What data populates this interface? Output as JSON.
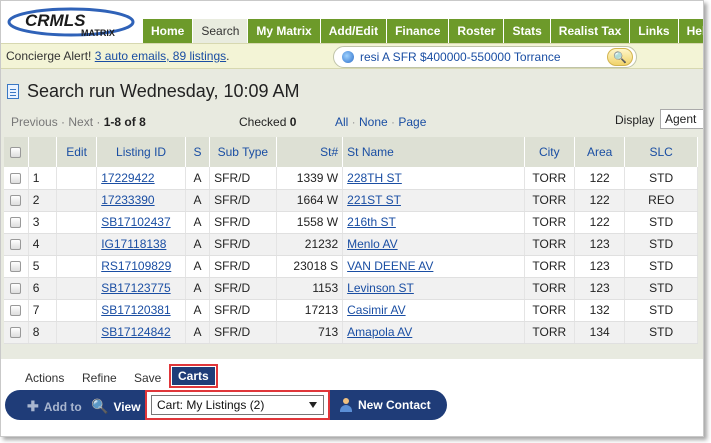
{
  "logo": {
    "brand": "CRMLS",
    "product": "MATRIX"
  },
  "nav": {
    "tabs": [
      {
        "label": "Home",
        "active": false
      },
      {
        "label": "Search",
        "active": true
      },
      {
        "label": "My Matrix",
        "active": false
      },
      {
        "label": "Add/Edit",
        "active": false
      },
      {
        "label": "Finance",
        "active": false
      },
      {
        "label": "Roster",
        "active": false
      },
      {
        "label": "Stats",
        "active": false
      },
      {
        "label": "Realist Tax",
        "active": false
      },
      {
        "label": "Links",
        "active": false
      },
      {
        "label": "Help",
        "active": false
      }
    ]
  },
  "concierge": {
    "label": "Concierge Alert!",
    "link": "3 auto emails, 89 listings",
    "period": "."
  },
  "search": {
    "value": "resi A SFR $400000-550000 Torrance"
  },
  "page": {
    "title": "Search run Wednesday, 10:09 AM"
  },
  "pager": {
    "previous": "Previous",
    "next": "Next",
    "range": "1-8",
    "of": "of",
    "total": "8"
  },
  "checked": {
    "label": "Checked",
    "count": "0"
  },
  "select_links": {
    "all": "All",
    "none": "None",
    "page": "Page"
  },
  "display": {
    "label": "Display",
    "value": "Agent"
  },
  "table": {
    "headers": [
      "",
      "",
      "Edit",
      "Listing ID",
      "S",
      "Sub Type",
      "St#",
      "St Name",
      "City",
      "Area",
      "SLC"
    ],
    "rows": [
      {
        "n": "1",
        "id": "17229422",
        "s": "A",
        "sub": "SFR/D",
        "stno": "1339 W",
        "stname": "228TH ST",
        "city": "TORR",
        "area": "122",
        "slc": "STD"
      },
      {
        "n": "2",
        "id": "17233390",
        "s": "A",
        "sub": "SFR/D",
        "stno": "1664 W",
        "stname": "221ST ST",
        "city": "TORR",
        "area": "122",
        "slc": "REO"
      },
      {
        "n": "3",
        "id": "SB17102437",
        "s": "A",
        "sub": "SFR/D",
        "stno": "1558 W",
        "stname": "216th ST",
        "city": "TORR",
        "area": "122",
        "slc": "STD"
      },
      {
        "n": "4",
        "id": "IG17118138",
        "s": "A",
        "sub": "SFR/D",
        "stno": "21232",
        "stname": "Menlo AV",
        "city": "TORR",
        "area": "123",
        "slc": "STD"
      },
      {
        "n": "5",
        "id": "RS17109829",
        "s": "A",
        "sub": "SFR/D",
        "stno": "23018 S",
        "stname": "VAN DEENE AV",
        "city": "TORR",
        "area": "123",
        "slc": "STD"
      },
      {
        "n": "6",
        "id": "SB17123775",
        "s": "A",
        "sub": "SFR/D",
        "stno": "1153",
        "stname": "Levinson ST",
        "city": "TORR",
        "area": "123",
        "slc": "STD"
      },
      {
        "n": "7",
        "id": "SB17120381",
        "s": "A",
        "sub": "SFR/D",
        "stno": "17213",
        "stname": "Casimir AV",
        "city": "TORR",
        "area": "132",
        "slc": "STD"
      },
      {
        "n": "8",
        "id": "SB17124842",
        "s": "A",
        "sub": "SFR/D",
        "stno": "713",
        "stname": "Amapola AV",
        "city": "TORR",
        "area": "134",
        "slc": "STD"
      }
    ]
  },
  "bottom_tabs": {
    "actions": "Actions",
    "refine": "Refine",
    "save": "Save",
    "carts": "Carts"
  },
  "actionbar": {
    "add_to": "Add to",
    "view": "View",
    "cart_select": "Cart: My Listings (2)",
    "new_contact": "New Contact"
  }
}
